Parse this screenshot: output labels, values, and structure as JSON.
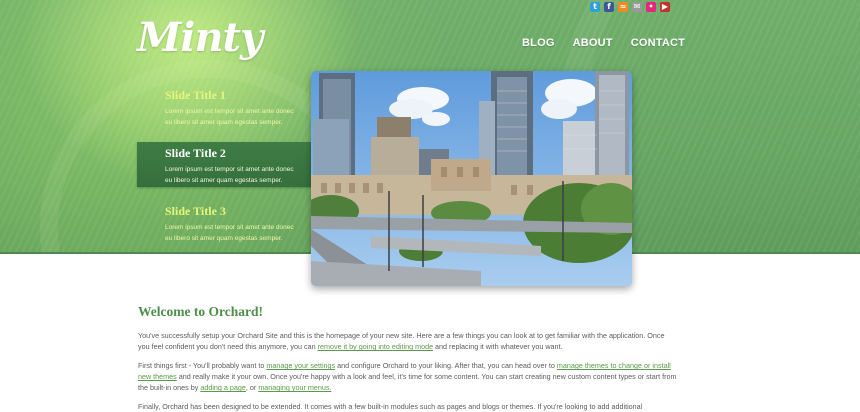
{
  "header": {
    "logo_text": "Minty",
    "social_icons": [
      "twitter-icon",
      "facebook-icon",
      "rss-icon",
      "email-icon",
      "flickr-icon",
      "youtube-icon"
    ],
    "nav": [
      "BLOG",
      "ABOUT",
      "CONTACT"
    ]
  },
  "slides": [
    {
      "title": "Slide Title 1",
      "body_line1": "Lorem ipsum est tempor sit amet ante donec",
      "body_line2": "eu libero sit amer quam egestas semper."
    },
    {
      "title": "Slide Title 2",
      "body_line1": "Lorem ipsum est tempor sit amet ante donec",
      "body_line2": "eu libero sit amer quam egestas semper."
    },
    {
      "title": "Slide Title 3",
      "body_line1": "Lorem ipsum est tempor sit amet ante donec",
      "body_line2": "eu libero sit amer quam egestas semper."
    }
  ],
  "active_slide": 2,
  "content": {
    "heading": "Welcome to Orchard!",
    "p1": {
      "t1": "You've successfully setup your Orchard Site and this is the homepage of your new site. Here are a few things you can look at to get familiar with the application. Once you feel confident you don't need this anymore, you can ",
      "link1": "remove it by going into editing mode",
      "t2": " and replacing it with whatever you want."
    },
    "p2": {
      "t1": "First things first - You'll probably want to ",
      "link1": "manage your settings",
      "t2": " and configure Orchard to your liking. After that, you can head over to ",
      "link2": "manage themes to change or install new themes",
      "t3": " and really make it your own. Once you're happy with a look and feel, it's time for some content. You can start creating new custom content types or start from the built-in ones by ",
      "link3": "adding a page",
      "t4": ", or ",
      "link4": "managing your menus."
    },
    "p3": {
      "t1": "Finally, Orchard has been designed to be extended. It comes with a few built-in modules such as pages and blogs or themes. If you're looking to add additional"
    }
  },
  "colors": {
    "hero_green": "#66a663",
    "slide_title": "#e6f57a",
    "active_slide_bg": "#3f7d45",
    "heading_green": "#4c8e4a",
    "link_green": "#5a9a4a"
  }
}
